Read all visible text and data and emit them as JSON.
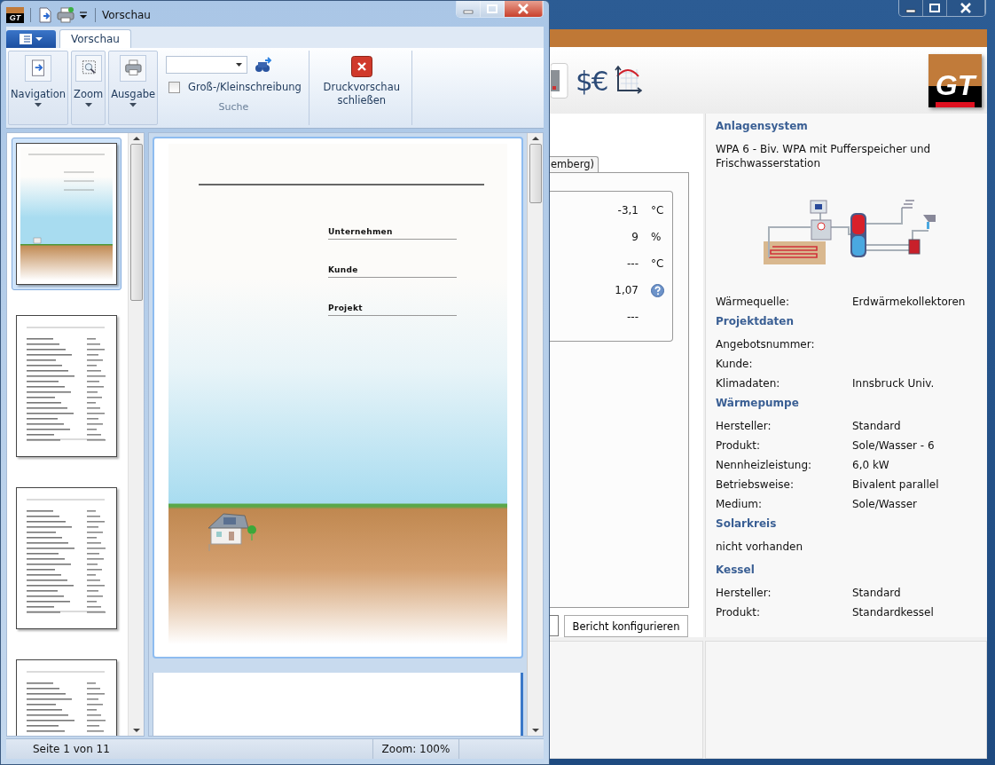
{
  "background_window": {
    "toolbar": {
      "currency_label": "$€",
      "logo": "GT"
    },
    "tab": {
      "label": "emberg)",
      "selected": true
    },
    "readings": [
      {
        "value": "-3,1",
        "unit": "°C"
      },
      {
        "value": "9",
        "unit": "%"
      },
      {
        "value": "---",
        "unit": "°C"
      },
      {
        "value": "1,07",
        "kind": "help"
      },
      {
        "value": "---"
      }
    ],
    "buttons": [
      "Bericht konfigurieren"
    ],
    "summary": [
      {
        "kind": "heading",
        "text": "Anlagensystem"
      },
      {
        "kind": "text",
        "text": "WPA 6 - Biv. WPA mit Pufferspeicher und Frischwasserstation"
      },
      {
        "kind": "diagram"
      },
      {
        "kind": "field",
        "label": "Wärmequelle:",
        "value": "Erdwärmekollektoren"
      },
      {
        "kind": "heading",
        "text": "Projektdaten"
      },
      {
        "kind": "field",
        "label": "Angebotsnummer:"
      },
      {
        "kind": "field",
        "label": "Kunde:"
      },
      {
        "kind": "field",
        "label": "Klimadaten:",
        "value": "Innsbruck Univ."
      },
      {
        "kind": "heading",
        "text": "Wärmepumpe"
      },
      {
        "kind": "field",
        "label": "Hersteller:",
        "value": "Standard"
      },
      {
        "kind": "field",
        "label": "Produkt:",
        "value": "Sole/Wasser -  6"
      },
      {
        "kind": "field",
        "label": "Nennheizleistung:",
        "value": "6,0 kW"
      },
      {
        "kind": "field",
        "label": "Betriebsweise:",
        "value": "Bivalent parallel"
      },
      {
        "kind": "field",
        "label": "Medium:",
        "value": "Sole/Wasser"
      },
      {
        "kind": "heading",
        "text": "Solarkreis"
      },
      {
        "kind": "text",
        "text": "nicht vorhanden"
      },
      {
        "kind": "heading",
        "text": "Kessel"
      },
      {
        "kind": "field",
        "label": "Hersteller:",
        "value": "Standard"
      },
      {
        "kind": "field",
        "label": "Produkt:",
        "value": "Standardkessel"
      }
    ]
  },
  "preview_window": {
    "app_icon": "GT",
    "title": "Vorschau",
    "tabs": [
      {
        "label": "Vorschau",
        "selected": true
      }
    ],
    "ribbon": [
      {
        "kind": "dropdown",
        "label": "Navigation"
      },
      {
        "kind": "dropdown",
        "label": "Zoom"
      },
      {
        "kind": "dropdown",
        "label": "Ausgabe"
      },
      {
        "kind": "search",
        "label": "Suche",
        "checkbox": {
          "label": "Groß-/Kleinschreibung",
          "checked": false
        }
      },
      {
        "kind": "button",
        "label": "Druckvorschau schließen"
      }
    ],
    "thumbnails": [
      {
        "kind": "cover",
        "selected": true
      },
      {
        "kind": "report",
        "selected": false
      },
      {
        "kind": "report",
        "selected": false
      },
      {
        "kind": "report",
        "selected": false
      }
    ],
    "page": {
      "fields": [
        "Unternehmen",
        "Kunde",
        "Projekt"
      ]
    },
    "status_bar": [
      "Seite 1 von 11",
      "Zoom: 100%"
    ]
  }
}
